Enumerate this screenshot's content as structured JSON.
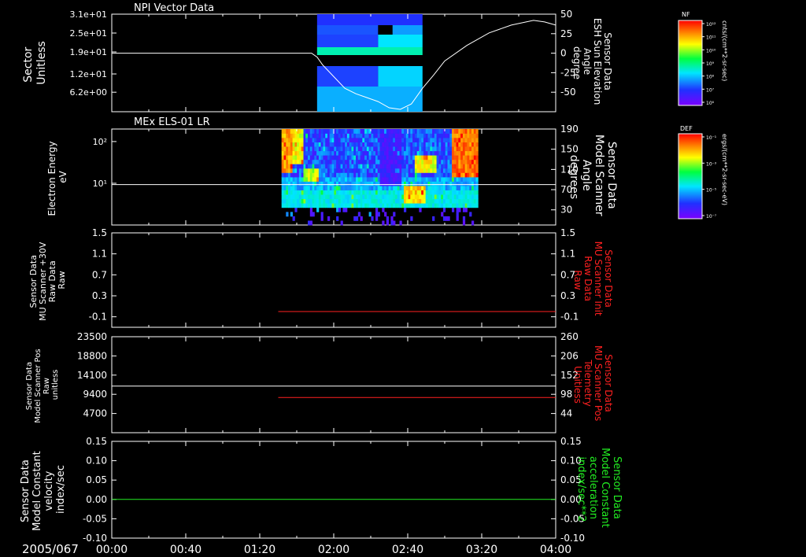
{
  "colors": {
    "background": "#000000",
    "axis": "#ffffff",
    "trace_white": "#ffffff",
    "trace_red": "#ff2020",
    "trace_green": "#22ee22",
    "label_red": "#ff2020",
    "label_green": "#22ee22"
  },
  "time_axis": {
    "date_label": "2005/067",
    "ticks": [
      "00:00",
      "00:40",
      "01:20",
      "02:00",
      "02:40",
      "03:20",
      "04:00"
    ],
    "range_hours": [
      0,
      4
    ]
  },
  "chart_data": [
    {
      "id": "panel1",
      "type": "heatmap",
      "title": "NPI Vector Data",
      "ylabel_left": [
        "Sector",
        "Unitless"
      ],
      "ylabel_right": [
        "Sensor Data",
        "ESH Sun Elevation",
        "Angle",
        "degree"
      ],
      "yticks_left": [
        "3.1e+01",
        "2.5e+01",
        "1.9e+01",
        "1.2e+01",
        "6.2e+00"
      ],
      "yticks_right": [
        "50",
        "25",
        "0",
        "-25",
        "-50"
      ],
      "ylim_left": [
        0,
        31
      ],
      "ylim_right": [
        -75,
        50
      ],
      "colorbar": {
        "title": "NF",
        "unit": "cnts/(cm**2-sr-sec)",
        "tick_labels": [
          "10¹²",
          "10¹¹",
          "10¹⁰",
          "10⁹",
          "10⁸",
          "10⁷",
          "10⁶"
        ]
      },
      "heatmap_blocks": [
        {
          "t0": 1.85,
          "t1": 2.8,
          "y0": 27.5,
          "y1": 31,
          "level": 0.18
        },
        {
          "t0": 1.85,
          "t1": 2.4,
          "y0": 24.5,
          "y1": 27.5,
          "level": 0.22
        },
        {
          "t0": 2.4,
          "t1": 2.53,
          "y0": 24.5,
          "y1": 27.5,
          "level": 0.02
        },
        {
          "t0": 2.53,
          "t1": 2.8,
          "y0": 24.5,
          "y1": 27.5,
          "level": 0.3
        },
        {
          "t0": 1.85,
          "t1": 2.4,
          "y0": 20.5,
          "y1": 24.5,
          "level": 0.2
        },
        {
          "t0": 2.4,
          "t1": 2.8,
          "y0": 20.5,
          "y1": 24.5,
          "level": 0.38
        },
        {
          "t0": 1.85,
          "t1": 2.8,
          "y0": 18,
          "y1": 20.5,
          "level": 0.45
        },
        {
          "t0": 1.85,
          "t1": 2.8,
          "y0": 14.5,
          "y1": 18,
          "level": 0.02
        },
        {
          "t0": 1.85,
          "t1": 2.4,
          "y0": 8,
          "y1": 14.5,
          "level": 0.2
        },
        {
          "t0": 2.4,
          "t1": 2.8,
          "y0": 8,
          "y1": 14.5,
          "level": 0.36
        },
        {
          "t0": 1.85,
          "t1": 2.8,
          "y0": 0,
          "y1": 8,
          "level": 0.32
        }
      ],
      "line_series": {
        "axis": "right",
        "x": [
          0,
          1.8,
          1.85,
          1.9,
          2.0,
          2.1,
          2.2,
          2.3,
          2.4,
          2.5,
          2.6,
          2.7,
          2.8,
          2.9,
          3.0,
          3.2,
          3.4,
          3.6,
          3.8,
          3.9,
          4.0
        ],
        "y": [
          0,
          0,
          -5,
          -15,
          -30,
          -45,
          -52,
          -57,
          -62,
          -70,
          -72,
          -65,
          -45,
          -28,
          -10,
          10,
          26,
          36,
          42,
          40,
          36
        ]
      }
    },
    {
      "id": "panel2",
      "type": "heatmap",
      "title": "MEx ELS-01 LR",
      "ylabel_left": [
        "Electron Energy",
        "eV"
      ],
      "ylabel_right": [
        "Sensor Data",
        "Model Scanner",
        "Angle",
        "degrees"
      ],
      "yticks_left": [
        "10²",
        "10¹"
      ],
      "yticks_right": [
        "190",
        "150",
        "110",
        "70",
        "30"
      ],
      "ylim_left_log": [
        0,
        2.3
      ],
      "ylim_right": [
        0,
        190
      ],
      "colorbar": {
        "title": "DEF",
        "unit": "ergs/(cm**2-sr-sec-eV)",
        "tick_labels": [
          "10⁻¹",
          "10⁻³",
          "10⁻⁵",
          "10⁻⁷"
        ]
      },
      "data_extent_hours": [
        1.53,
        3.3
      ],
      "hot_spots": [
        {
          "t0": 1.53,
          "t1": 1.62,
          "y0": 1.2,
          "y1": 2.2,
          "level": 0.9
        },
        {
          "t0": 1.62,
          "t1": 1.72,
          "y0": 1.4,
          "y1": 2.3,
          "level": 0.8
        },
        {
          "t0": 1.72,
          "t1": 1.85,
          "y0": 1.0,
          "y1": 1.3,
          "level": 0.75
        },
        {
          "t0": 2.62,
          "t1": 2.82,
          "y0": 0.5,
          "y1": 0.9,
          "level": 0.85
        },
        {
          "t0": 2.72,
          "t1": 2.92,
          "y0": 1.2,
          "y1": 1.6,
          "level": 0.8
        },
        {
          "t0": 3.05,
          "t1": 3.3,
          "y0": 1.1,
          "y1": 2.3,
          "level": 0.95
        }
      ],
      "line_series": {
        "axis": "right",
        "x": [
          0,
          4
        ],
        "y": [
          80,
          80
        ]
      }
    },
    {
      "id": "panel3",
      "type": "line",
      "ylabel_left": [
        "Sensor Data",
        "MU Scanner +30V",
        "Raw Data",
        "Raw"
      ],
      "ylabel_right": [
        "Sensor Data",
        "MU Scanner Init",
        "Raw Data",
        "Raw"
      ],
      "yticks_left": [
        "1.5",
        "1.1",
        "0.7",
        "0.3",
        "-0.1"
      ],
      "yticks_right": [
        "1.5",
        "1.1",
        "0.7",
        "0.3",
        "-0.1"
      ],
      "ylim": [
        -0.3,
        1.5
      ],
      "series": [
        {
          "color_key": "trace_red",
          "x": [
            1.5,
            4.0
          ],
          "y": [
            0,
            0
          ]
        }
      ]
    },
    {
      "id": "panel4",
      "type": "line",
      "ylabel_left": [
        "Sensor Data",
        "Model Scanner Pos",
        "Raw",
        "unitless"
      ],
      "ylabel_right": [
        "Sensor Data",
        "MU Scanner Pos",
        "Telemetry",
        "Unitless"
      ],
      "yticks_left": [
        "23500",
        "18800",
        "14100",
        "9400",
        "4700"
      ],
      "yticks_right": [
        "260",
        "206",
        "152",
        "98",
        "44"
      ],
      "ylim_left": [
        0,
        23500
      ],
      "ylim_right": [
        -10,
        260
      ],
      "series": [
        {
          "color_key": "trace_white",
          "axis": "left",
          "x": [
            0,
            4.0
          ],
          "y": [
            11400,
            11400
          ]
        },
        {
          "color_key": "trace_red",
          "axis": "right",
          "x": [
            1.5,
            4.0
          ],
          "y": [
            89,
            89
          ]
        }
      ]
    },
    {
      "id": "panel5",
      "type": "line",
      "ylabel_left": [
        "Sensor Data",
        "Model Constant",
        "velocity",
        "index/sec"
      ],
      "ylabel_right": [
        "Sensor Data",
        "Model Constant",
        "acceleration",
        "index/sec**2"
      ],
      "yticks_left": [
        "0.15",
        "0.10",
        "0.05",
        "0.00",
        "-0.05",
        "-0.10"
      ],
      "yticks_right": [
        "0.15",
        "0.10",
        "0.05",
        "0.00",
        "-0.05",
        "-0.10"
      ],
      "ylim": [
        -0.1,
        0.15
      ],
      "series": [
        {
          "color_key": "trace_green",
          "x": [
            0,
            4.0
          ],
          "y": [
            0,
            0
          ]
        }
      ]
    }
  ]
}
